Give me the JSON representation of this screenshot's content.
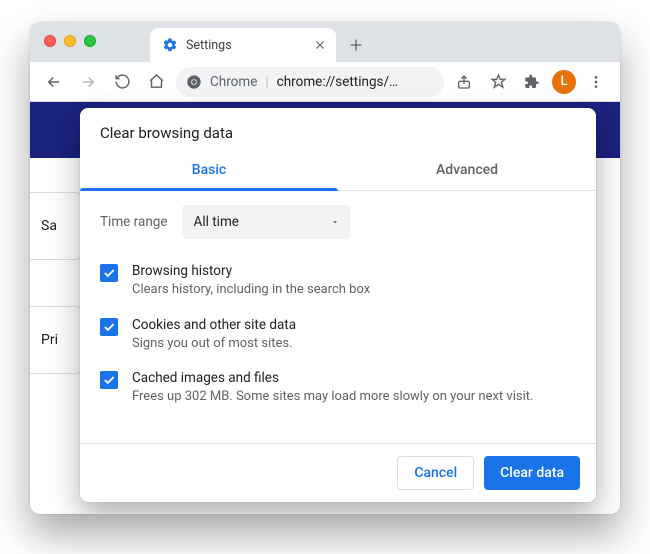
{
  "window": {
    "tab_title": "Settings",
    "omnibox_label": "Chrome",
    "omnibox_url": "chrome://settings/…",
    "avatar_initial": "L"
  },
  "background": {
    "cards": [
      "Sa",
      "Pri"
    ]
  },
  "dialog": {
    "title": "Clear browsing data",
    "tabs": [
      "Basic",
      "Advanced"
    ],
    "active_tab": 0,
    "time_range": {
      "label": "Time range",
      "value": "All time"
    },
    "options": [
      {
        "checked": true,
        "title": "Browsing history",
        "desc": "Clears history, including in the search box"
      },
      {
        "checked": true,
        "title": "Cookies and other site data",
        "desc": "Signs you out of most sites."
      },
      {
        "checked": true,
        "title": "Cached images and files",
        "desc": "Frees up 302 MB. Some sites may load more slowly on your next visit."
      }
    ],
    "buttons": {
      "cancel": "Cancel",
      "confirm": "Clear data"
    }
  }
}
